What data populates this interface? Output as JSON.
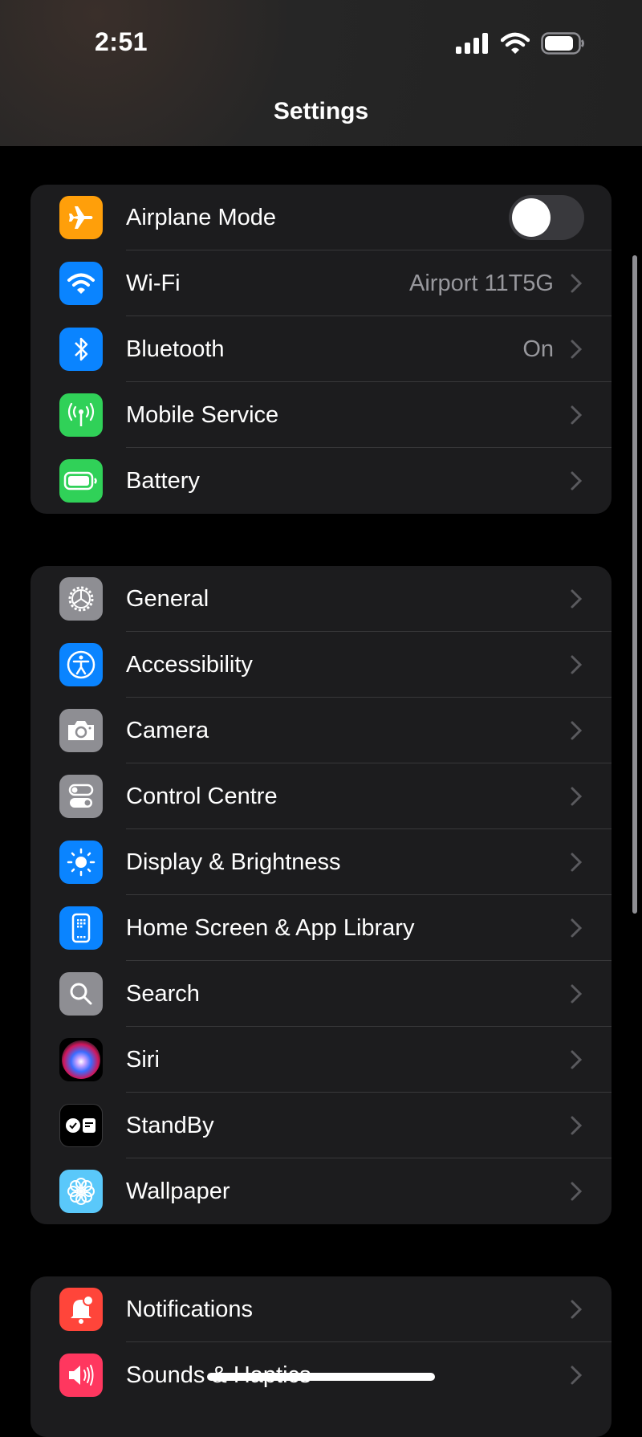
{
  "status_bar": {
    "time": "2:51",
    "icons": [
      "cellular-signal-icon",
      "wifi-icon",
      "battery-icon"
    ]
  },
  "nav": {
    "title": "Settings"
  },
  "groups": [
    {
      "rows": [
        {
          "label": "Airplane Mode",
          "icon": "airplane-icon",
          "icon_bg": "#ff9f0a",
          "toggle": true,
          "toggle_on": false
        },
        {
          "label": "Wi-Fi",
          "icon": "wifi-icon",
          "icon_bg": "#0a84ff",
          "value": "Airport 11T5G"
        },
        {
          "label": "Bluetooth",
          "icon": "bluetooth-icon",
          "icon_bg": "#0a84ff",
          "value": "On"
        },
        {
          "label": "Mobile Service",
          "icon": "antenna-icon",
          "icon_bg": "#30d158"
        },
        {
          "label": "Battery",
          "icon": "battery-icon",
          "icon_bg": "#30d158"
        }
      ]
    },
    {
      "rows": [
        {
          "label": "General",
          "icon": "gear-icon",
          "icon_bg": "#8e8e93"
        },
        {
          "label": "Accessibility",
          "icon": "accessibility-icon",
          "icon_bg": "#0a84ff"
        },
        {
          "label": "Camera",
          "icon": "camera-icon",
          "icon_bg": "#8e8e93"
        },
        {
          "label": "Control Centre",
          "icon": "switches-icon",
          "icon_bg": "#8e8e93"
        },
        {
          "label": "Display & Brightness",
          "icon": "sun-icon",
          "icon_bg": "#0a84ff"
        },
        {
          "label": "Home Screen & App Library",
          "icon": "phone-grid-icon",
          "icon_bg": "#0a84ff"
        },
        {
          "label": "Search",
          "icon": "magnifier-icon",
          "icon_bg": "#8e8e93"
        },
        {
          "label": "Siri",
          "icon": "siri-icon",
          "icon_bg": "#1c1c1e"
        },
        {
          "label": "StandBy",
          "icon": "standby-icon",
          "icon_bg": "#000000"
        },
        {
          "label": "Wallpaper",
          "icon": "flower-icon",
          "icon_bg": "#5ac8fa"
        }
      ]
    },
    {
      "rows": [
        {
          "label": "Notifications",
          "icon": "bell-icon",
          "icon_bg": "#ff453a"
        },
        {
          "label": "Sounds & Haptics",
          "icon": "speaker-icon",
          "icon_bg": "#ff375f"
        }
      ]
    }
  ]
}
